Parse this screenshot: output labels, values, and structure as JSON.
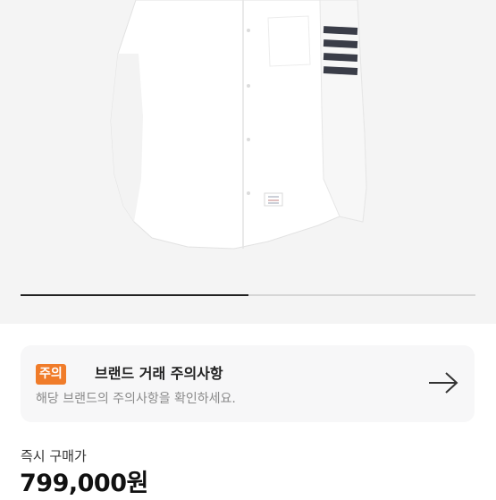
{
  "product": {
    "image_alt_icon": "white-shirt-with-stripes",
    "image_progress": 0.5
  },
  "notice": {
    "badge": "주의",
    "title": "브랜드 거래 주의사항",
    "subtitle": "해당 브랜드의 주의사항을 확인하세요.",
    "icon": "arrow-right-icon",
    "badge_color": "#f07c2a"
  },
  "price": {
    "label": "즉시 구매가",
    "value": "799,000원"
  }
}
